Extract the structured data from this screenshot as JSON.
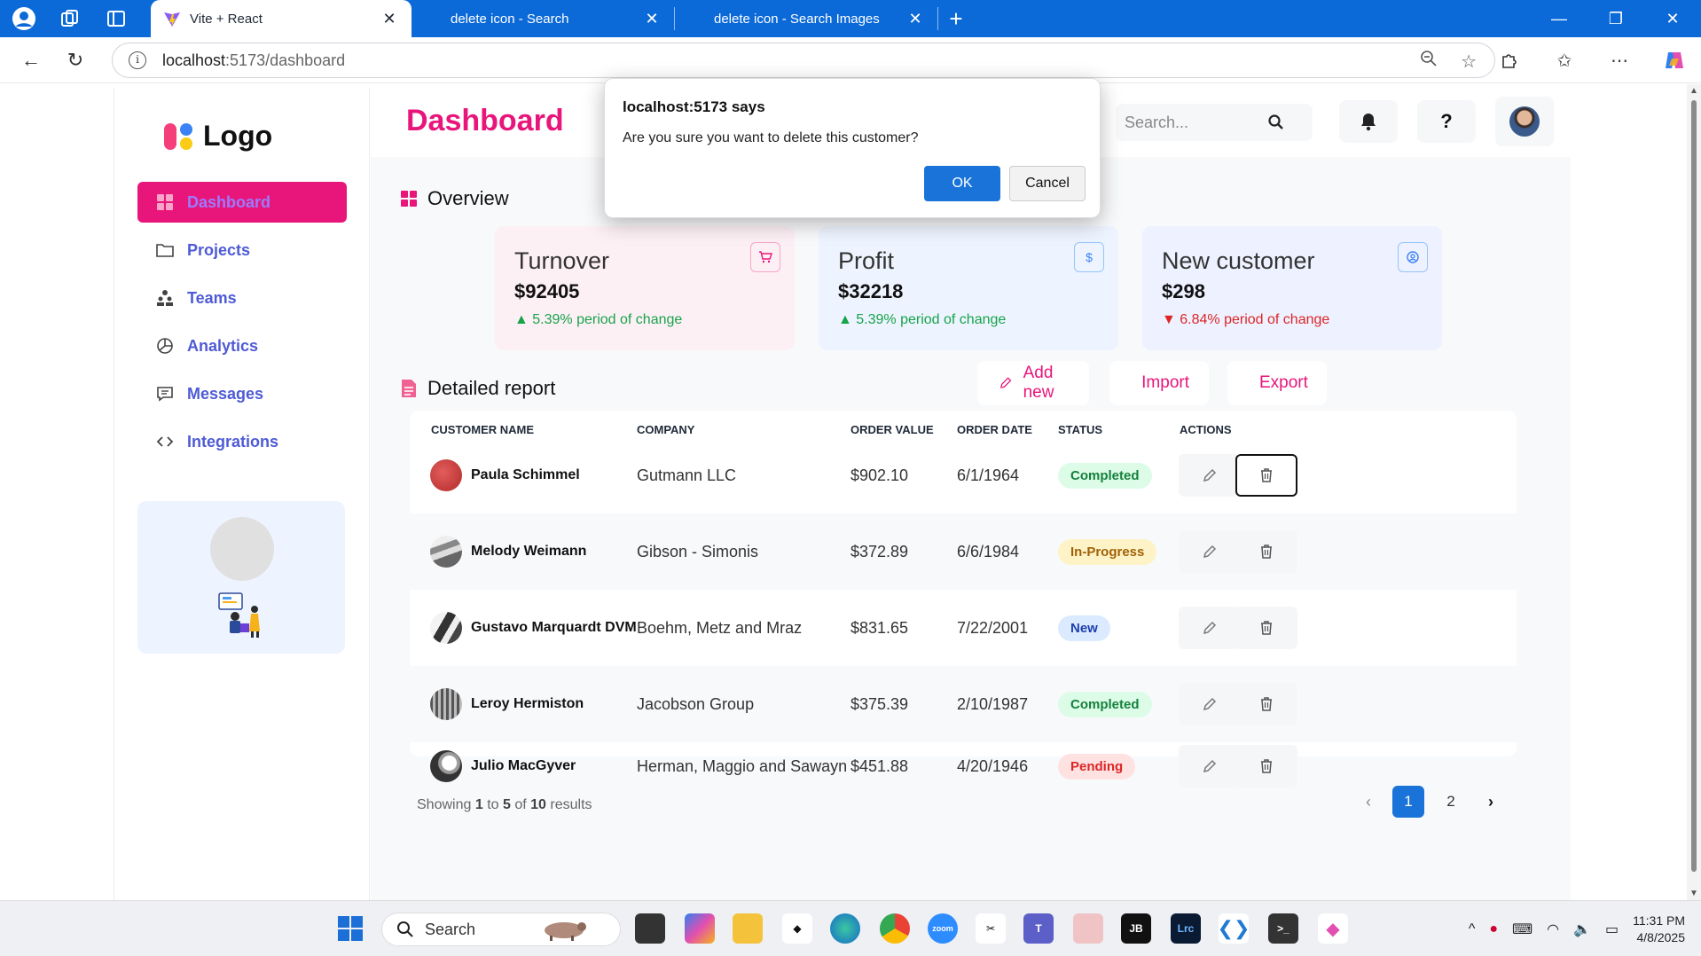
{
  "browser": {
    "tabs": [
      {
        "title": "Vite + React",
        "active": true
      },
      {
        "title": "delete icon - Search",
        "active": false
      },
      {
        "title": "delete icon - Search Images",
        "active": false
      }
    ],
    "url_host": "localhost",
    "url_path": ":5173/dashboard"
  },
  "sidebar": {
    "logo_text": "Logo",
    "items": [
      {
        "label": "Dashboard",
        "icon": "grid-icon"
      },
      {
        "label": "Projects",
        "icon": "folder-icon"
      },
      {
        "label": "Teams",
        "icon": "team-icon"
      },
      {
        "label": "Analytics",
        "icon": "pie-chart-icon"
      },
      {
        "label": "Messages",
        "icon": "message-icon"
      },
      {
        "label": "Integrations",
        "icon": "code-icon"
      }
    ]
  },
  "header": {
    "title": "Dashboard",
    "search_placeholder": "Search...",
    "help_label": "?"
  },
  "overview": {
    "title": "Overview",
    "cards": [
      {
        "title": "Turnover",
        "value": "$92405",
        "change": "5.39% period of change",
        "trend": "up",
        "icon": "cart-icon",
        "icon_glyph": "🛒"
      },
      {
        "title": "Profit",
        "value": "$32218",
        "change": "5.39% period of change",
        "trend": "up",
        "icon": "dollar-icon",
        "icon_glyph": "$"
      },
      {
        "title": "New customer",
        "value": "$298",
        "change": "6.84% period of change",
        "trend": "down",
        "icon": "user-icon",
        "icon_glyph": "@"
      }
    ]
  },
  "report": {
    "title": "Detailed report",
    "buttons": {
      "add": "Add new",
      "import": "Import",
      "export": "Export"
    },
    "columns": [
      "CUSTOMER NAME",
      "COMPANY",
      "ORDER VALUE",
      "ORDER DATE",
      "STATUS",
      "ACTIONS"
    ],
    "rows": [
      {
        "name": "Paula Schimmel",
        "company": "Gutmann LLC",
        "value": "$902.10",
        "date": "6/1/1964",
        "status": "Completed"
      },
      {
        "name": "Melody Weimann",
        "company": "Gibson - Simonis",
        "value": "$372.89",
        "date": "6/6/1984",
        "status": "In-Progress"
      },
      {
        "name": "Gustavo Marquardt DVM",
        "company": "Boehm, Metz and Mraz",
        "value": "$831.65",
        "date": "7/22/2001",
        "status": "New"
      },
      {
        "name": "Leroy Hermiston",
        "company": "Jacobson Group",
        "value": "$375.39",
        "date": "2/10/1987",
        "status": "Completed"
      },
      {
        "name": "Julio MacGyver",
        "company": "Herman, Maggio and Sawayn",
        "value": "$451.88",
        "date": "4/20/1946",
        "status": "Pending"
      }
    ],
    "footer": {
      "prefix": "Showing",
      "from": "1",
      "to_word": "to",
      "to": "5",
      "of_word": "of",
      "total": "10",
      "suffix": "results"
    },
    "pages": [
      "1",
      "2"
    ],
    "current_page": "1"
  },
  "dialog": {
    "title": "localhost:5173 says",
    "message": "Are you sure you want to delete this customer?",
    "ok": "OK",
    "cancel": "Cancel"
  },
  "taskbar": {
    "search": "Search",
    "time": "11:31 PM",
    "date": "4/8/2025"
  },
  "colors": {
    "accent": "#e8157a",
    "link": "#4f5bd5",
    "primary_button": "#1a73d9",
    "browser_frame": "#0c6ad8"
  }
}
